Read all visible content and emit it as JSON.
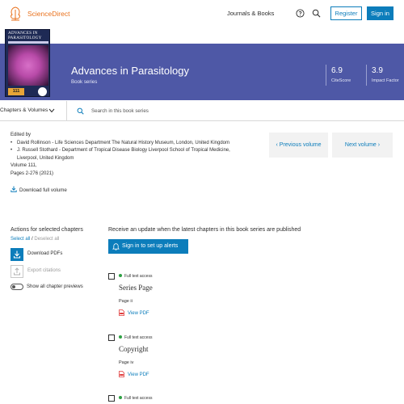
{
  "header": {
    "brand": "ScienceDirect",
    "journals_books": "Journals & Books",
    "register": "Register",
    "sign_in": "Sign in"
  },
  "banner": {
    "cover": {
      "title": "ADVANCES IN PARASITOLOGY",
      "volume": "111"
    },
    "title": "Advances in Parasitology",
    "subtitle": "Book series",
    "metrics": [
      {
        "value": "6.9",
        "label": "CiteScore"
      },
      {
        "value": "3.9",
        "label": "Impact Factor"
      }
    ],
    "color": "#4e58a6"
  },
  "toolbar": {
    "chapters_volumes": "Chapters & Volumes",
    "search_placeholder": "Search in this book series"
  },
  "volume_info": {
    "edited_by": "Edited by",
    "editors": [
      "David Rollinson - Life Sciences Department The Natural History Museum, London, United Kingdom",
      "J. Russell Stothard - Department of Tropical Disease Biology Liverpool School of Tropical Medicine,",
      "Liverpool, United Kingdom"
    ],
    "volume": "Volume 111,",
    "pages": "Pages 2-276 (2021)",
    "download_full": "Download full volume"
  },
  "navigation": {
    "previous": "Previous volume",
    "next": "Next volume"
  },
  "actions": {
    "title": "Actions for selected chapters",
    "select_all": "Select all",
    "separator": "/",
    "deselect_all": "Deselect all",
    "download_pdfs": "Download PDFs",
    "export_citations": "Export citations",
    "show_previews": "Show all chapter previews"
  },
  "alerts": {
    "text": "Receive an update when the latest chapters in this book series are published",
    "button": "Sign in to set up alerts"
  },
  "chapters": [
    {
      "access": "Full text access",
      "title": "Series Page",
      "page": "Page ii",
      "pdf": "View PDF"
    },
    {
      "access": "Full text access",
      "title": "Copyright",
      "page": "Page iv",
      "pdf": "View PDF"
    },
    {
      "access": "Full text access"
    }
  ],
  "colors": {
    "accent": "#0c7dbb",
    "brand": "#e9711c",
    "access_dot": "#2ea043"
  }
}
